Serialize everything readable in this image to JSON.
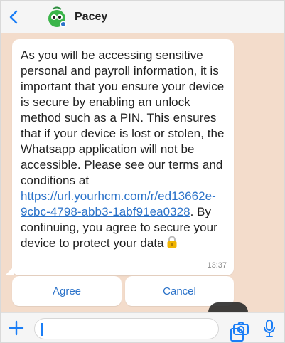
{
  "header": {
    "contact_name": "Pacey"
  },
  "message": {
    "text_before_link": "As you will be accessing sensitive personal and payroll information, it is important that you ensure your device is secure by enabling an unlock method such as a PIN. This ensures that if your device is lost or stolen, the Whatsapp application will not be accessible. Please see our terms and conditions at ",
    "link": "https://url.yourhcm.com/r/ed13662e-9cbc-4798-abb3-1abf91ea0328",
    "text_after_link": ". By continuing, you agree to secure your device to protect your data",
    "time": "13:37"
  },
  "actions": {
    "agree": "Agree",
    "cancel": "Cancel"
  },
  "colors": {
    "accent": "#2c73c9",
    "header_bg": "#f5f5f5",
    "chat_bg": "#f3dccb"
  },
  "icons": {
    "back": "chevron-left",
    "avatar": "pacey-logo",
    "lock": "lock",
    "plus": "plus",
    "sticker": "sticker",
    "camera": "camera",
    "mic": "microphone"
  }
}
